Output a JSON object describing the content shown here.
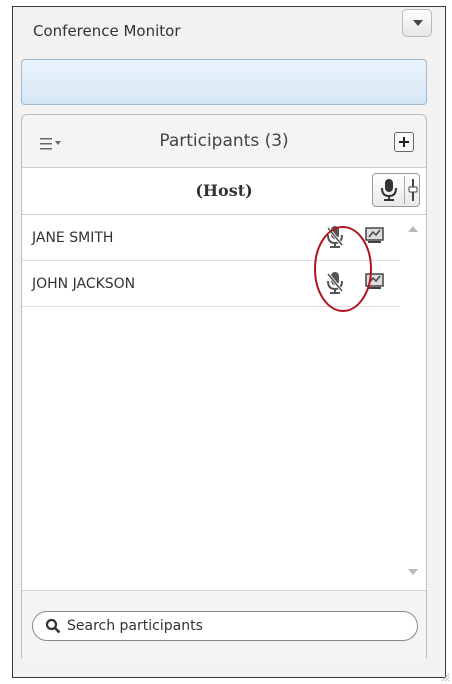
{
  "window": {
    "title": "Conference Monitor"
  },
  "participants": {
    "header_title": "Participants (3)",
    "host_label": "(Host)",
    "list": [
      {
        "name": "JANE SMITH",
        "mic": "mic-muted-icon",
        "screen": "screen-share-icon"
      },
      {
        "name": "JOHN JACKSON",
        "mic": "mic-muted-icon",
        "screen": "screen-share-icon"
      }
    ]
  },
  "search": {
    "placeholder": "Search participants"
  },
  "colors": {
    "annotation_circle": "#b0141c",
    "status_bar": "#d6e7f4"
  }
}
